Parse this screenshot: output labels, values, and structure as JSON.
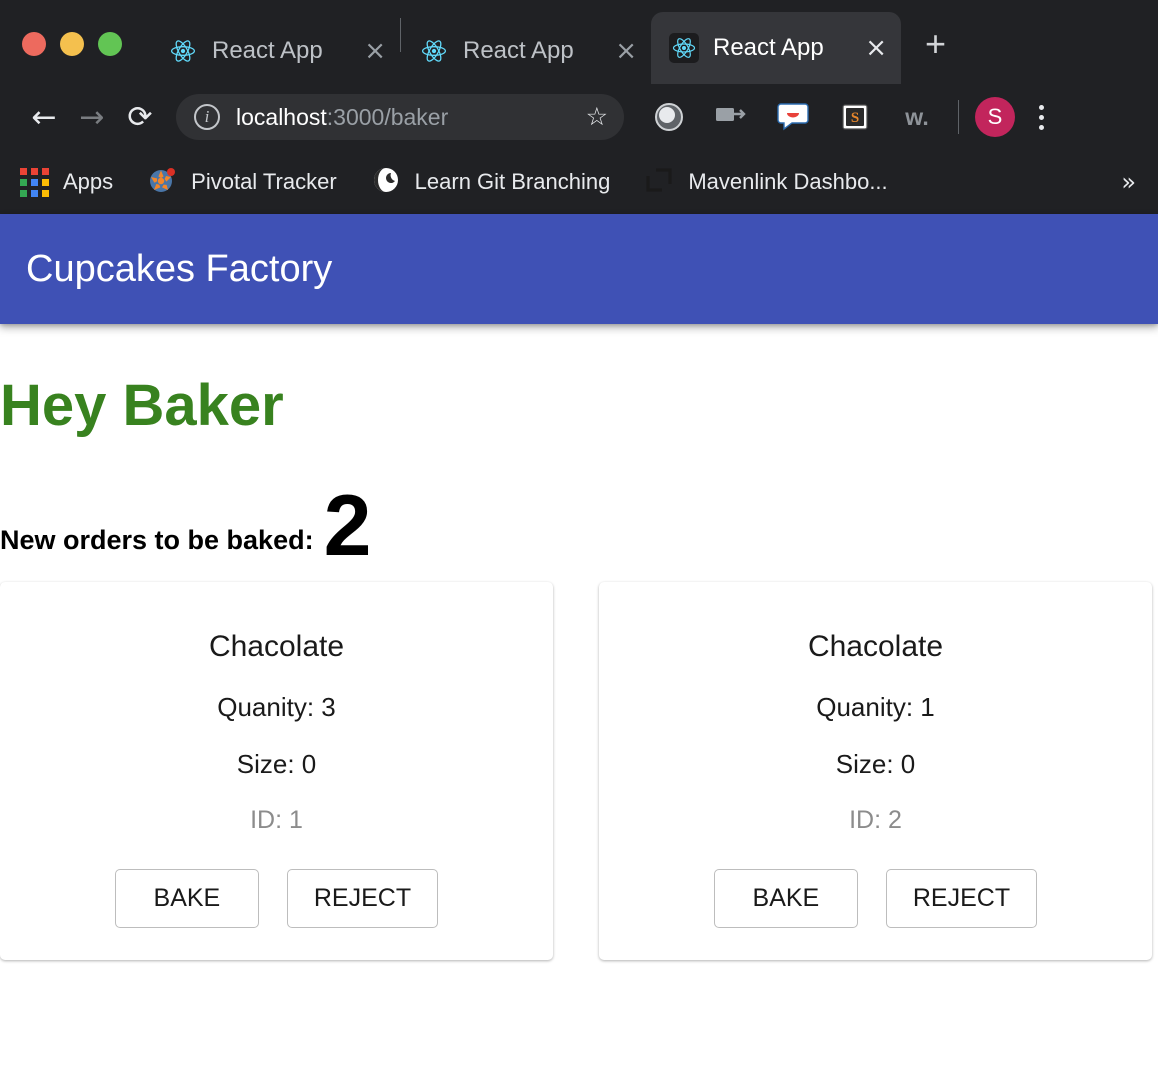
{
  "browser": {
    "window_controls": [
      "close",
      "minimize",
      "maximize"
    ],
    "tabs": [
      {
        "title": "React App",
        "favicon": "react-icon",
        "close": "×",
        "active": false
      },
      {
        "title": "React App",
        "favicon": "react-icon",
        "close": "×",
        "active": false
      },
      {
        "title": "React App",
        "favicon": "react-icon",
        "close": "×",
        "active": true
      }
    ],
    "new_tab_label": "+",
    "toolbar": {
      "back": "←",
      "forward": "→",
      "reload": "⟳",
      "info_icon": "i",
      "url_host": "localhost",
      "url_path": ":3000/baker",
      "bookmark_star": "☆",
      "extensions": [
        "sphere-icon",
        "cast-icon",
        "smiley-chat-icon",
        "sublime-s-icon",
        "w-dot-icon"
      ],
      "w_icon_label": "w.",
      "s_icon_label": "S",
      "avatar_initial": "S",
      "avatar_color": "#c2255c",
      "menu": "kebab-menu"
    },
    "bookmarks": [
      {
        "label": "Apps",
        "icon": "apps-grid-icon"
      },
      {
        "label": "Pivotal Tracker",
        "icon": "pivotal-tracker-icon"
      },
      {
        "label": "Learn Git Branching",
        "icon": "globe-icon"
      },
      {
        "label": "Mavenlink Dashbo...",
        "icon": "corner-brackets-icon"
      }
    ],
    "bookmarks_overflow": "»"
  },
  "app": {
    "appbar": {
      "title": "Cupcakes Factory",
      "color": "#3f51b5"
    },
    "heading": "Hey Baker",
    "heading_color": "#38821f",
    "orders_label": "New orders to be baked:",
    "orders_count": "2",
    "orders": [
      {
        "flavor": "Chacolate",
        "quantity_label": "Quanity: 3",
        "size_label": "Size: 0",
        "id_label": "ID: 1",
        "bake_label": "BAKE",
        "reject_label": "REJECT"
      },
      {
        "flavor": "Chacolate",
        "quantity_label": "Quanity: 1",
        "size_label": "Size: 0",
        "id_label": "ID: 2",
        "bake_label": "BAKE",
        "reject_label": "REJECT"
      }
    ]
  }
}
